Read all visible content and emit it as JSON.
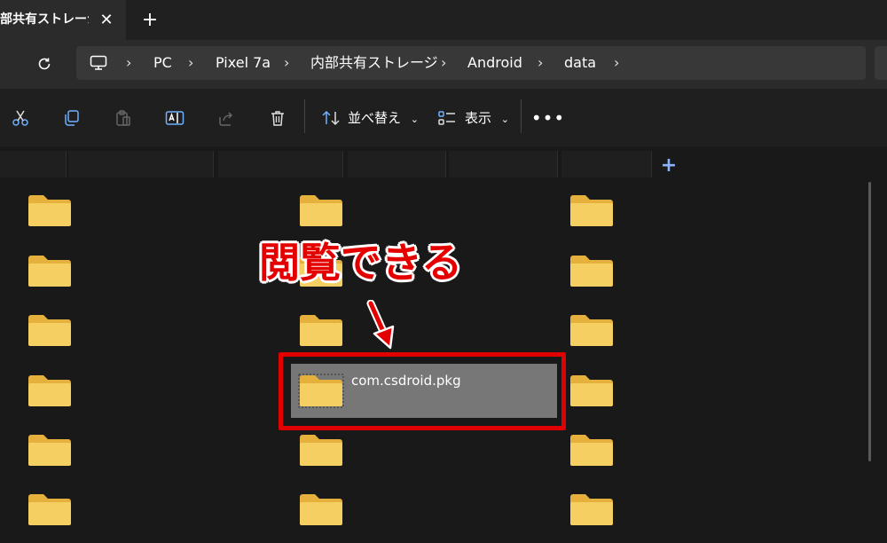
{
  "tab": {
    "title": "部共有ストレージ",
    "close_label": "✕",
    "new_label": "+"
  },
  "breadcrumb": {
    "items": [
      "PC",
      "Pixel 7a",
      "内部共有ストレージ",
      "Android",
      "data"
    ]
  },
  "toolbar": {
    "sort_label": "並べ替え",
    "view_label": "表示"
  },
  "selected_item": {
    "name": "com.csdroid.pkg"
  },
  "annotation": {
    "text": "閲覧できる",
    "color": "#e50000"
  },
  "colors": {
    "highlight": "#e00000",
    "folder": "#f6cf62",
    "selection": "#777777"
  },
  "icons": [
    "pc-icon",
    "refresh-icon",
    "cut-icon",
    "copy-icon",
    "paste-icon",
    "rename-icon",
    "share-icon",
    "delete-icon",
    "sort-icon",
    "view-icon",
    "more-icon",
    "folder-icon",
    "add-icon"
  ]
}
